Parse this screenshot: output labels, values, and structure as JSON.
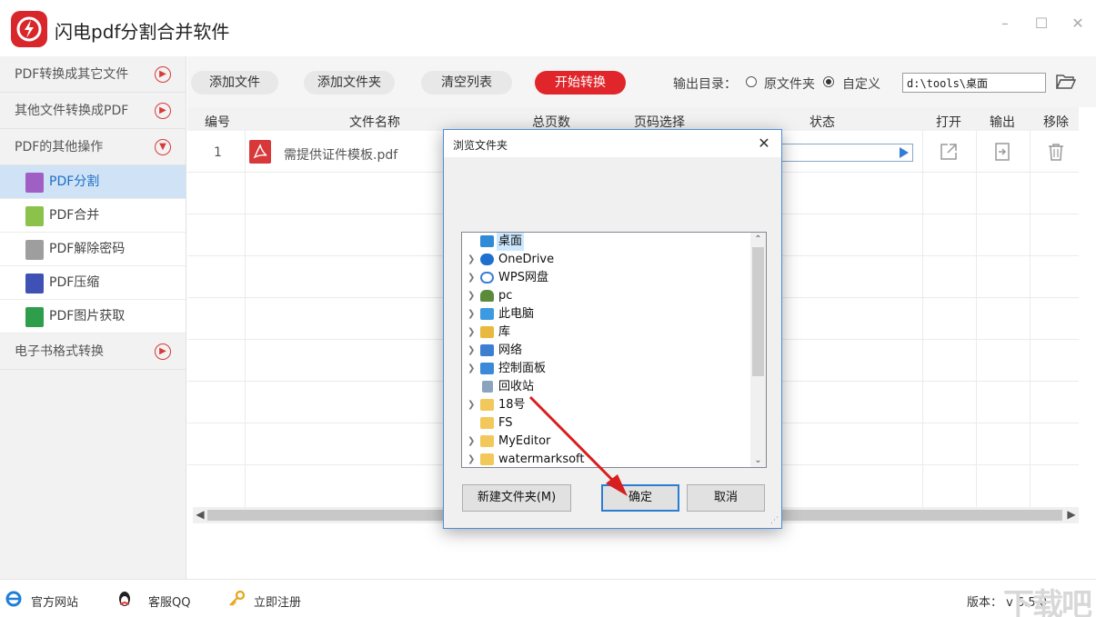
{
  "app": {
    "title": "闪电pdf分割合并软件"
  },
  "sidebar": {
    "categories": [
      {
        "label": "PDF转换成其它文件"
      },
      {
        "label": "其他文件转换成PDF"
      },
      {
        "label": "PDF的其他操作"
      },
      {
        "label": "电子书格式转换"
      }
    ],
    "sub_items": [
      {
        "label": "PDF分割",
        "color": "#a05fc4"
      },
      {
        "label": "PDF合并",
        "color": "#8bc34a"
      },
      {
        "label": "PDF解除密码",
        "color": "#9e9e9e"
      },
      {
        "label": "PDF压缩",
        "color": "#3f51b5"
      },
      {
        "label": "PDF图片获取",
        "color": "#2e9e4a"
      }
    ]
  },
  "toolbar": {
    "add_file": "添加文件",
    "add_folder": "添加文件夹",
    "clear_list": "清空列表",
    "start": "开始转换",
    "output_label": "输出目录：",
    "radio_original": "原文件夹",
    "radio_custom": "自定义",
    "output_path": "d:\\tools\\桌面"
  },
  "table": {
    "headers": [
      "编号",
      "文件名称",
      "总页数",
      "页码选择",
      "状态",
      "打开",
      "输出",
      "移除"
    ],
    "rows": [
      {
        "index": "1",
        "filename": "需提供证件模板.pdf"
      }
    ]
  },
  "footer": {
    "website": "官方网站",
    "support": "客服QQ",
    "register": "立即注册",
    "version": "版本： v 6.5.0",
    "watermark": "下载吧"
  },
  "dialog": {
    "title": "浏览文件夹",
    "tree": [
      {
        "label": "桌面",
        "icon": "desktop-icon",
        "color": "#2f8ad8",
        "expandable": false,
        "selected": true
      },
      {
        "label": "OneDrive",
        "icon": "onedrive-icon",
        "color": "#1f6fd1",
        "expandable": true
      },
      {
        "label": "WPS网盘",
        "icon": "wps-cloud-icon",
        "color": "#3a7fd5",
        "expandable": true
      },
      {
        "label": "pc",
        "icon": "user-icon",
        "color": "#5a8a3a",
        "expandable": true
      },
      {
        "label": "此电脑",
        "icon": "computer-icon",
        "color": "#3c9be0",
        "expandable": true
      },
      {
        "label": "库",
        "icon": "library-icon",
        "color": "#e8b93e",
        "expandable": true
      },
      {
        "label": "网络",
        "icon": "network-icon",
        "color": "#3c7fd0",
        "expandable": true
      },
      {
        "label": "控制面板",
        "icon": "control-panel-icon",
        "color": "#3a8ad8",
        "expandable": true
      },
      {
        "label": "回收站",
        "icon": "recycle-bin-icon",
        "color": "#8aa4c0",
        "expandable": false
      },
      {
        "label": "18号",
        "icon": "folder-icon",
        "color": "#f2c85a",
        "expandable": true
      },
      {
        "label": "FS",
        "icon": "folder-icon",
        "color": "#f2c85a",
        "expandable": false
      },
      {
        "label": "MyEditor",
        "icon": "folder-icon",
        "color": "#f2c85a",
        "expandable": true
      },
      {
        "label": "watermarksoft",
        "icon": "folder-icon",
        "color": "#f2c85a",
        "expandable": true
      }
    ],
    "new_folder": "新建文件夹(M)",
    "ok": "确定",
    "cancel": "取消"
  }
}
